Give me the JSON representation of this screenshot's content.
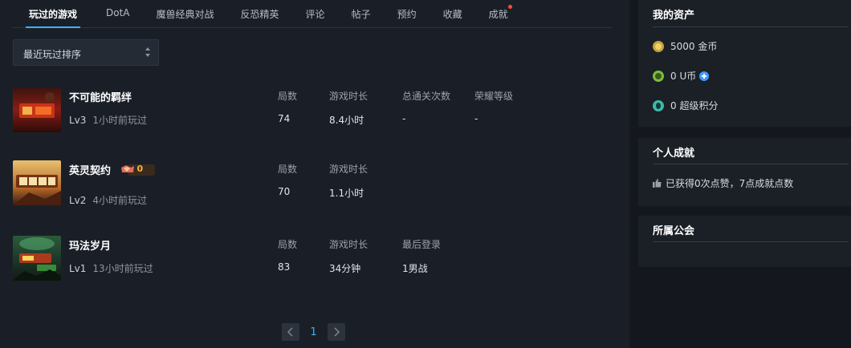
{
  "tabs": [
    {
      "label": "玩过的游戏",
      "active": true
    },
    {
      "label": "DotA"
    },
    {
      "label": "魔兽经典对战"
    },
    {
      "label": "反恐精英"
    },
    {
      "label": "评论"
    },
    {
      "label": "帖子"
    },
    {
      "label": "预约"
    },
    {
      "label": "收藏"
    },
    {
      "label": "成就",
      "notification_dot": true
    }
  ],
  "sort": {
    "selected": "最近玩过排序"
  },
  "games": [
    {
      "name": "不可能的羁绊",
      "level": "Lv3",
      "last_played": "1小时前玩过",
      "stats": [
        {
          "label": "局数",
          "value": "74"
        },
        {
          "label": "游戏时长",
          "value": "8.4小时"
        },
        {
          "label": "总通关次数",
          "value": "-"
        },
        {
          "label": "荣耀等级",
          "value": "-"
        }
      ]
    },
    {
      "name": "英灵契约",
      "badge_value": "0",
      "level": "Lv2",
      "last_played": "4小时前玩过",
      "stats": [
        {
          "label": "局数",
          "value": "70"
        },
        {
          "label": "游戏时长",
          "value": "1.1小时"
        }
      ]
    },
    {
      "name": "玛法岁月",
      "level": "Lv1",
      "last_played": "13小时前玩过",
      "stats": [
        {
          "label": "局数",
          "value": "83"
        },
        {
          "label": "游戏时长",
          "value": "34分钟"
        },
        {
          "label": "最后登录",
          "value": "1男战"
        }
      ]
    }
  ],
  "pagination": {
    "current": "1"
  },
  "assets": {
    "title": "我的资产",
    "gold": {
      "icon": "gold-coin-icon",
      "text": "5000 金币",
      "color": "#c8a53a"
    },
    "ucoin": {
      "icon": "u-coin-icon",
      "text": "0 U币",
      "color": "#7cbf3a"
    },
    "points": {
      "icon": "super-points-icon",
      "text": "0 超级积分",
      "color": "#3fb9a8"
    }
  },
  "achievements": {
    "title": "个人成就",
    "summary": "已获得0次点赞，7点成就点数"
  },
  "guild": {
    "title": "所属公会"
  },
  "colors": {
    "accent": "#3db1ff",
    "background": "#1a1f27",
    "panel": "#1b2027",
    "notification": "#ff4a3a"
  }
}
